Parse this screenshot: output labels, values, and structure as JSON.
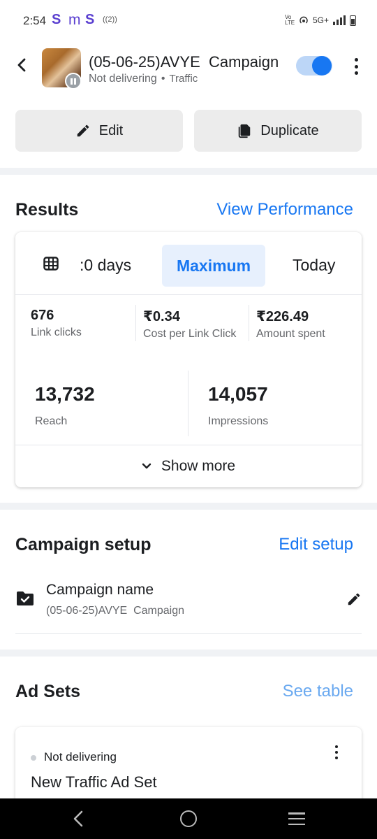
{
  "status_bar": {
    "time": "2:54",
    "app_icons": [
      "S",
      "m",
      "S"
    ],
    "small_icon_text": "((2))",
    "volte_label": "Vo LTE",
    "network_label": "5G+"
  },
  "header": {
    "title": "(05-06-25)AVYE  Campaign",
    "status": "Not delivering",
    "separator": "•",
    "objective": "Traffic",
    "toggle_on": true
  },
  "actions": {
    "edit_label": "Edit",
    "duplicate_label": "Duplicate"
  },
  "results": {
    "title": "Results",
    "link": "View Performance",
    "tabs": {
      "days_label": ":0 days",
      "maximum_label": "Maximum",
      "today_label": "Today",
      "selected": "Maximum"
    },
    "metrics": [
      {
        "value": "676",
        "label": "Link clicks"
      },
      {
        "value": "₹0.34",
        "label": "Cost per Link Click"
      },
      {
        "value": "₹226.49",
        "label": "Amount spent"
      }
    ],
    "big_metrics": [
      {
        "value": "13,732",
        "label": "Reach"
      },
      {
        "value": "14,057",
        "label": "Impressions"
      }
    ],
    "show_more": "Show more"
  },
  "campaign_setup": {
    "title": "Campaign setup",
    "link": "Edit setup",
    "name_label": "Campaign name",
    "name_value": "(05-06-25)AVYE  Campaign"
  },
  "ad_sets": {
    "title": "Ad Sets",
    "link": "See table",
    "items": [
      {
        "status": "Not delivering",
        "name": "New Traffic Ad Set"
      }
    ]
  },
  "colors": {
    "accent": "#1877f2",
    "accent_light": "#e7f0fd",
    "divider": "#f0f2f5",
    "button_bg": "#ececec",
    "text_secondary": "#65676b",
    "status_dot": "#ccd0d5"
  }
}
